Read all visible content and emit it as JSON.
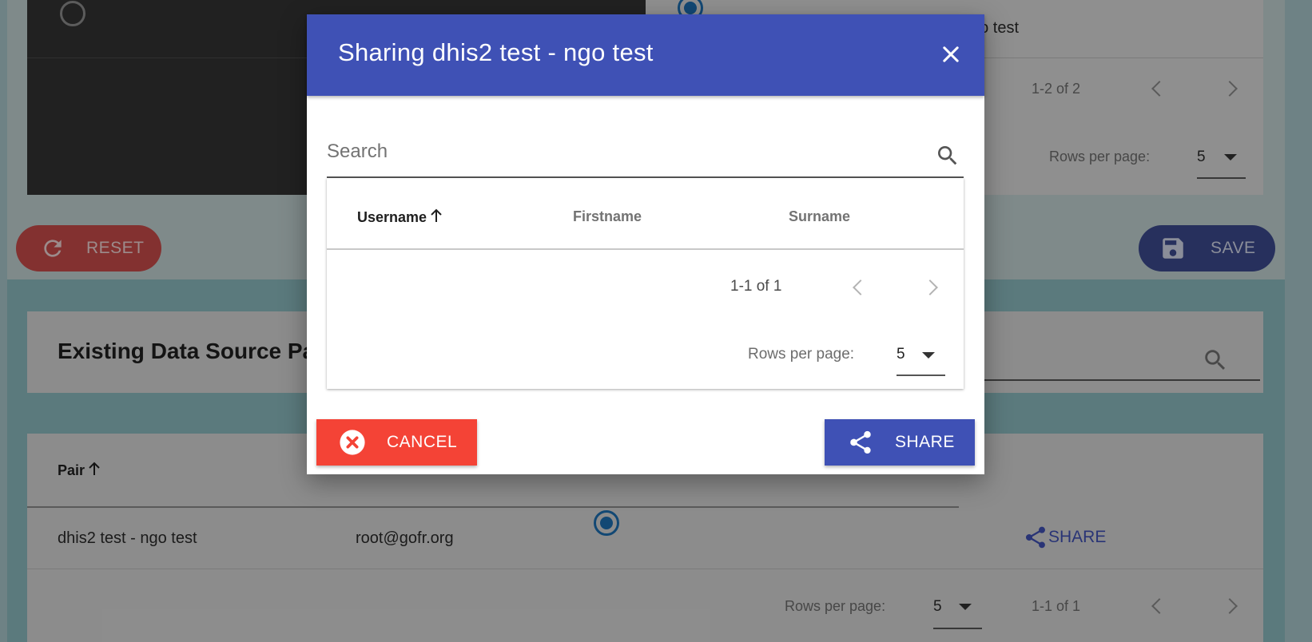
{
  "background": {
    "top_card": {
      "text_partial": "go test",
      "pagination": "1-2 of 2",
      "rows_per_page_label": "Rows per page:",
      "rows_per_page_value": "5"
    },
    "reset_label": "RESET",
    "save_label": "SAVE",
    "section_title": "Existing Data Source Pai",
    "table": {
      "headers": {
        "pair": "Pair"
      },
      "rows": [
        {
          "pair": "dhis2 test - ngo test",
          "owner": "root@gofr.org",
          "action": "SHARE"
        }
      ],
      "rows_per_page_label": "Rows per page:",
      "rows_per_page_value": "5",
      "pagination": "1-1 of 1"
    }
  },
  "dialog": {
    "title": "Sharing dhis2 test - ngo test",
    "search_placeholder": "Search",
    "columns": [
      "Username",
      "Firstname",
      "Surname"
    ],
    "pagination": "1-1 of 1",
    "rows_per_page_label": "Rows per page:",
    "rows_per_page_value": "5",
    "cancel_label": "CANCEL",
    "share_label": "SHARE"
  },
  "colors": {
    "primary": "#3f51b5",
    "danger": "#f44336",
    "radio": "#1d6fb3"
  }
}
